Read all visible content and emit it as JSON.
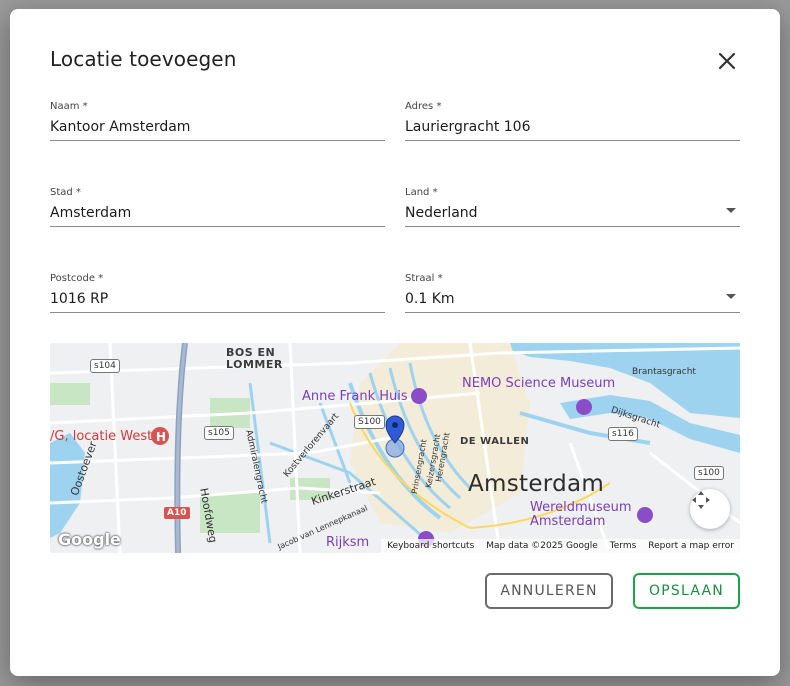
{
  "dialog": {
    "title": "Locatie toevoegen",
    "close_icon": "close-icon"
  },
  "form": {
    "name": {
      "label": "Naam *",
      "value": "Kantoor Amsterdam"
    },
    "address": {
      "label": "Adres *",
      "value": "Lauriergracht 106"
    },
    "city": {
      "label": "Stad *",
      "value": "Amsterdam"
    },
    "country": {
      "label": "Land *",
      "value": "Nederland"
    },
    "postcode": {
      "label": "Postcode *",
      "value": "1016 RP"
    },
    "radius": {
      "label": "Straal *",
      "value": "0.1 Km"
    }
  },
  "map": {
    "labels": {
      "bos_en_lommer": "BOS EN\nLOMMER",
      "anne_frank": "Anne Frank Huis",
      "nemo": "NEMO Science Museum",
      "de_wallen": "DE WALLEN",
      "amsterdam": "Amsterdam",
      "wereldmuseum": "Wereldmuseum\nAmsterdam",
      "olvg": "/G, locatie West",
      "rijks": "Rijksm",
      "kinkerstraat": "Kinkerstraat",
      "hoofdweg": "Hoofdweg",
      "oostoever": "Oostoever",
      "admiralengracht": "Admiralengracht",
      "jacob": "Jacob van Lennepkanaal",
      "kostverloren": "Kostverlorenvaart",
      "prinsengracht": "Prinsengracht",
      "keizersgracht": "Keizersgracht",
      "herengracht": "Herengracht",
      "dijksgracht": "Dijksgracht",
      "brantasgracht": "Brantasgracht"
    },
    "routes": [
      "s104",
      "s105",
      "s100",
      "S100",
      "s116",
      "s100",
      "A10"
    ],
    "attribution": {
      "keyboard": "Keyboard shortcuts",
      "data": "Map data ©2025 Google",
      "terms": "Terms",
      "report": "Report a map error"
    },
    "google": "Google"
  },
  "actions": {
    "cancel": "ANNULEREN",
    "save": "OPSLAAN"
  },
  "colors": {
    "save_accent": "#1aa34a",
    "cancel_border": "#6b6b6b",
    "water": "#9ed3ef",
    "marker": "#2f5bd8"
  }
}
